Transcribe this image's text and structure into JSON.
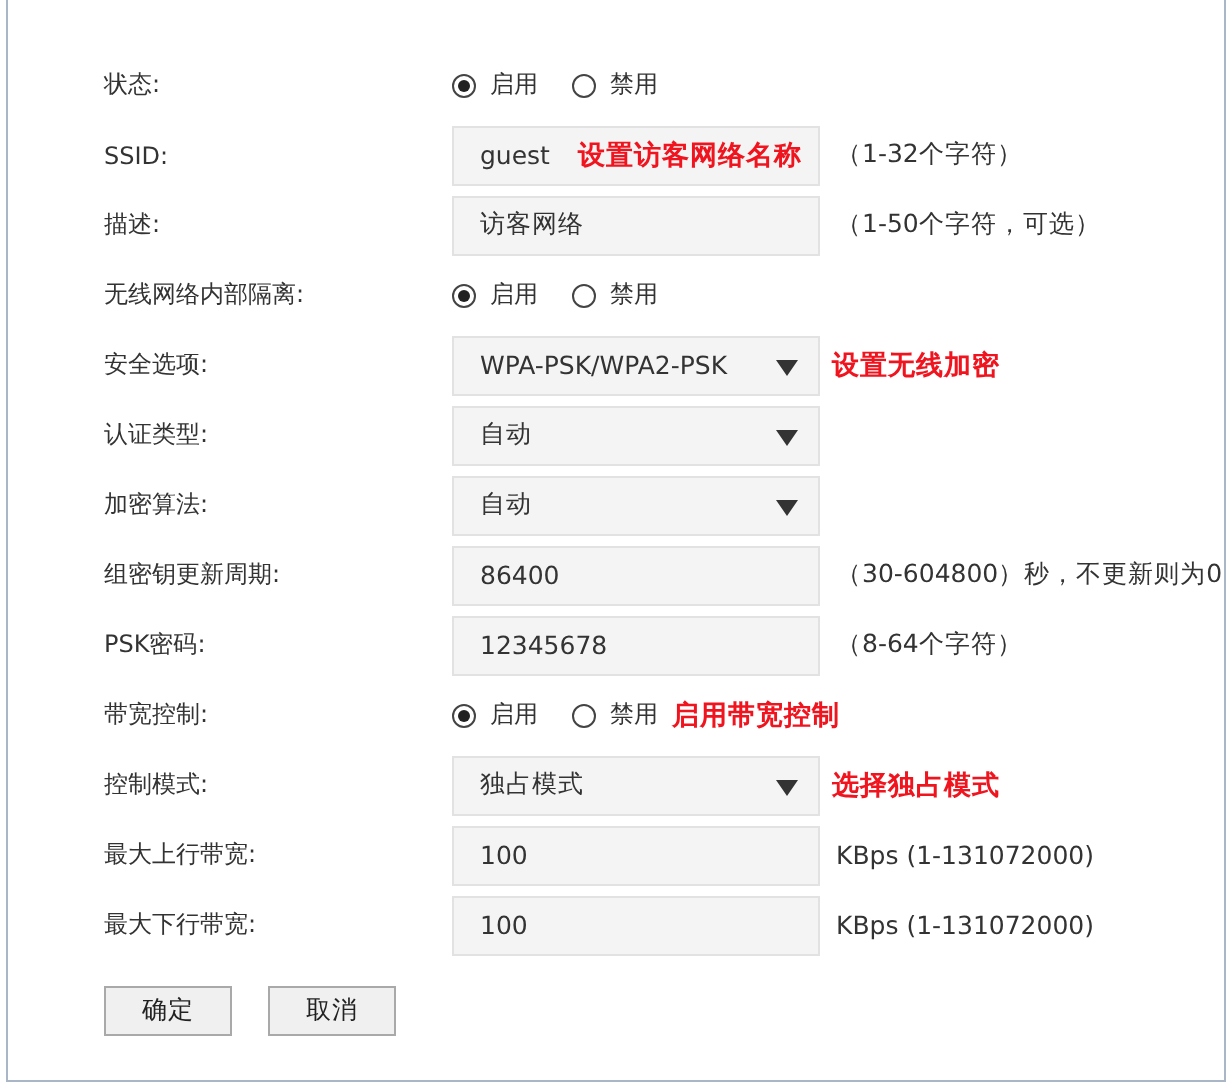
{
  "rows": [
    {
      "kind": "radio",
      "label": "状态:",
      "options": [
        {
          "label": "启用",
          "selected": true
        },
        {
          "label": "禁用",
          "selected": false
        }
      ]
    },
    {
      "kind": "input",
      "label": "SSID:",
      "value": "guest",
      "note": "设置访客网络名称",
      "hint": "（1-32个字符）"
    },
    {
      "kind": "input",
      "label": "描述:",
      "value": "访客网络",
      "hint": "（1-50个字符，可选）"
    },
    {
      "kind": "radio",
      "label": "无线网络内部隔离:",
      "options": [
        {
          "label": "启用",
          "selected": true
        },
        {
          "label": "禁用",
          "selected": false
        }
      ]
    },
    {
      "kind": "select",
      "label": "安全选项:",
      "value": "WPA-PSK/WPA2-PSK",
      "note": "设置无线加密"
    },
    {
      "kind": "select",
      "label": "认证类型:",
      "value": "自动"
    },
    {
      "kind": "select",
      "label": "加密算法:",
      "value": "自动"
    },
    {
      "kind": "input",
      "label": "组密钥更新周期:",
      "value": "86400",
      "hint": "（30-604800）秒，不更新则为0"
    },
    {
      "kind": "input",
      "label": "PSK密码:",
      "value": "12345678",
      "hint": "（8-64个字符）"
    },
    {
      "kind": "radio",
      "label": "带宽控制:",
      "options": [
        {
          "label": "启用",
          "selected": true
        },
        {
          "label": "禁用",
          "selected": false
        }
      ],
      "note": "启用带宽控制"
    },
    {
      "kind": "select",
      "label": "控制模式:",
      "value": "独占模式",
      "note": "选择独占模式"
    },
    {
      "kind": "input",
      "label": "最大上行带宽:",
      "value": "100",
      "hint": "KBps (1-131072000)"
    },
    {
      "kind": "input",
      "label": "最大下行带宽:",
      "value": "100",
      "hint": "KBps (1-131072000)"
    }
  ],
  "buttons": [
    "确定",
    "取消"
  ]
}
